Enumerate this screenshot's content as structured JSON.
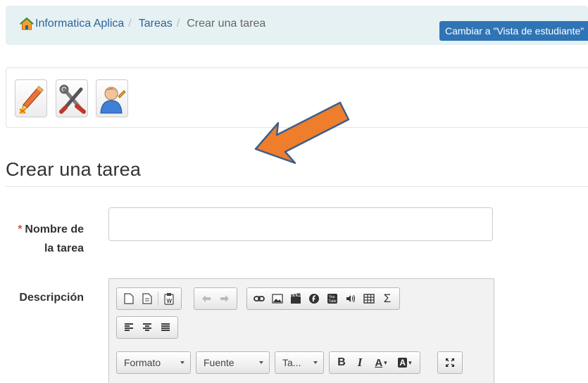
{
  "breadcrumb": {
    "items": [
      "Informatica Aplica",
      "Tareas"
    ],
    "separator": "/",
    "current": "Crear una tarea"
  },
  "header": {
    "switch_view_label": "Cambiar a \"Vista de estudiante\""
  },
  "toolbar": {
    "buttons": [
      "edit-settings-icon",
      "tools-icon",
      "user-edit-icon"
    ]
  },
  "page": {
    "title": "Crear una tarea"
  },
  "form": {
    "required_marker": "*",
    "name_label_line1": "Nombre de",
    "name_label_line2": "la tarea",
    "name_value": "",
    "description_label": "Descripción"
  },
  "editor": {
    "format_label": "Formato",
    "font_label": "Fuente",
    "size_label": "Ta...",
    "bold_label": "B",
    "italic_label": "I",
    "text_color_label": "A",
    "bg_color_label": "A",
    "sigma_label": "Σ"
  },
  "colors": {
    "breadcrumb_bg": "#e6f1f3",
    "link": "#2a6496",
    "button_primary": "#2f74b5",
    "required": "#d9534f",
    "arrow": "#ee7d2c"
  }
}
